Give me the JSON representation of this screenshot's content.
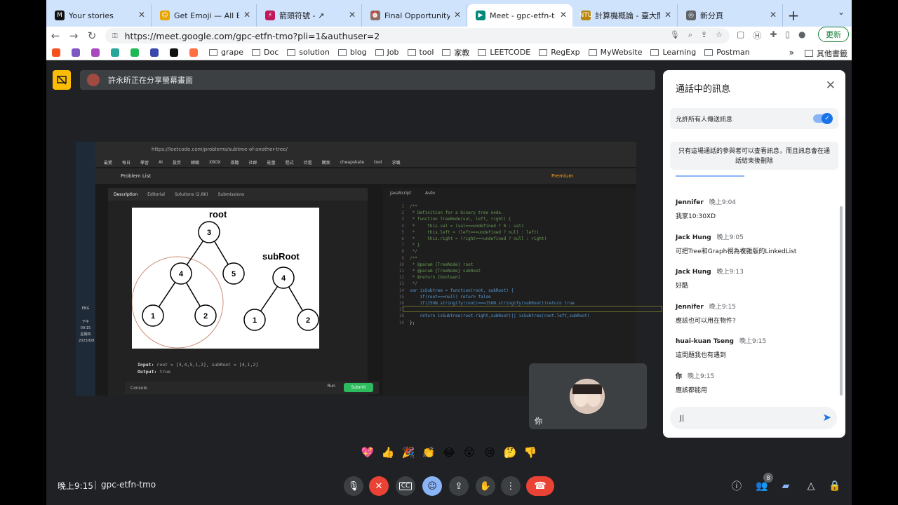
{
  "browser": {
    "tabs": [
      {
        "title": "Your stories",
        "fav": "M",
        "color": "#111111"
      },
      {
        "title": "Get Emoji — All Em",
        "fav": "☺",
        "color": "#e8a300"
      },
      {
        "title": "箭頭符號 - ↗",
        "fav": "⚡",
        "color": "#c2185b"
      },
      {
        "title": "Final Opportunity",
        "fav": "⏰",
        "color": "#8d6e63"
      },
      {
        "title": "Meet - gpc-etfn-t",
        "fav": "▶",
        "color": "#00897b"
      },
      {
        "title": "計算機概論 - 臺大開放",
        "fav": "NTU",
        "color": "#b8860b"
      },
      {
        "title": "新分頁",
        "fav": "◎",
        "color": "#5f6368"
      }
    ],
    "url": "https://meet.google.com/gpc-etfn-tmo?pli=1&authuser=2",
    "update_label": "更新",
    "bookmarks": [
      "grape",
      "Doc",
      "solution",
      "blog",
      "Job",
      "tool",
      "家教",
      "LEETCODE",
      "RegExp",
      "MyWebsite",
      "Learning",
      "Postman"
    ],
    "other_bookmarks": "其他書籤"
  },
  "meet": {
    "presenting_text": "許永昕正在分享螢幕畫面",
    "self_label": "你",
    "clock": "晚上9:15",
    "separator": "|",
    "meeting_code": "gpc-etfn-tmo",
    "participant_count": "8",
    "reactions": [
      "💖",
      "👍",
      "🎉",
      "👏",
      "😂",
      "😮",
      "😢",
      "🤔",
      "👎"
    ]
  },
  "shared_screen": {
    "url": "https://leetcode.com/problems/subtree-of-another-tree/",
    "problem_list": "Problem List",
    "premium": "Premium",
    "tabs": [
      "Description",
      "Editorial",
      "Solutions (2.6K)",
      "Submissions"
    ],
    "lang": "JavaScript",
    "auto": "Auto",
    "tree_root_label": "root",
    "tree_sub_label": "subRoot",
    "input_label": "Input:",
    "input_value": "root = [3,4,5,1,2], subRoot = [4,1,2]",
    "output_label": "Output:",
    "output_value": "true",
    "console": "Console",
    "run": "Run",
    "submit": "Submit",
    "bookmarks": [
      "最愛",
      "每日",
      "學習",
      "AI",
      "投資",
      "轉職",
      "XBOX",
      "視聽",
      "社群",
      "能量",
      "程式",
      "待看",
      "購案",
      "cheapskate",
      "tool",
      "求職"
    ],
    "taskbar": {
      "lang": "ENG",
      "time": "下午 09:15",
      "day": "星期四",
      "date": "2023/6/8"
    },
    "code_lines": [
      "/**",
      " * Definition for a binary tree node.",
      " * function TreeNode(val, left, right) {",
      " *     this.val = (val===undefined ? 0 : val)",
      " *     this.left = (left===undefined ? null : left)",
      " *     this.right = (right===undefined ? null : right)",
      " * }",
      " */",
      "/**",
      " * @param {TreeNode} root",
      " * @param {TreeNode} subRoot",
      " * @return {boolean}",
      " */",
      "var isSubtree = function(root, subRoot) {",
      "    if(root===null) return false",
      "    if(JSON.stringify(root)===JSON.stringify(subRoot))return true",
      "",
      "    return isSubtree(root.right,subRoot)|| isSubtree(root.left,subRoot)",
      "};"
    ]
  },
  "chat": {
    "title": "通話中的訊息",
    "allow_label": "允許所有人傳送訊息",
    "notice": "只有這場通話的參與者可以查看訊息，而且訊息會在通話結束後刪除",
    "messages": [
      {
        "sender": "Jennifer",
        "time": "晚上9:04",
        "text": "我家10:30XD"
      },
      {
        "sender": "Jack Hung",
        "time": "晚上9:05",
        "text": "可把Tree和Graph視為複雜版的LinkedList"
      },
      {
        "sender": "Jack Hung",
        "time": "晚上9:13",
        "text": "好酷"
      },
      {
        "sender": "Jennifer",
        "time": "晚上9:15",
        "text": "應該也可以用在物件?"
      },
      {
        "sender": "huai-kuan Tseng",
        "time": "晚上9:15",
        "text": "這問題我也有遇到"
      },
      {
        "sender": "你",
        "time": "晚上9:15",
        "text": "應該都能用"
      }
    ],
    "input_value": "J|"
  },
  "colors": {
    "accent": "#1a73e8",
    "hangup": "#ea4335",
    "present_badge": "#fbbc04"
  }
}
